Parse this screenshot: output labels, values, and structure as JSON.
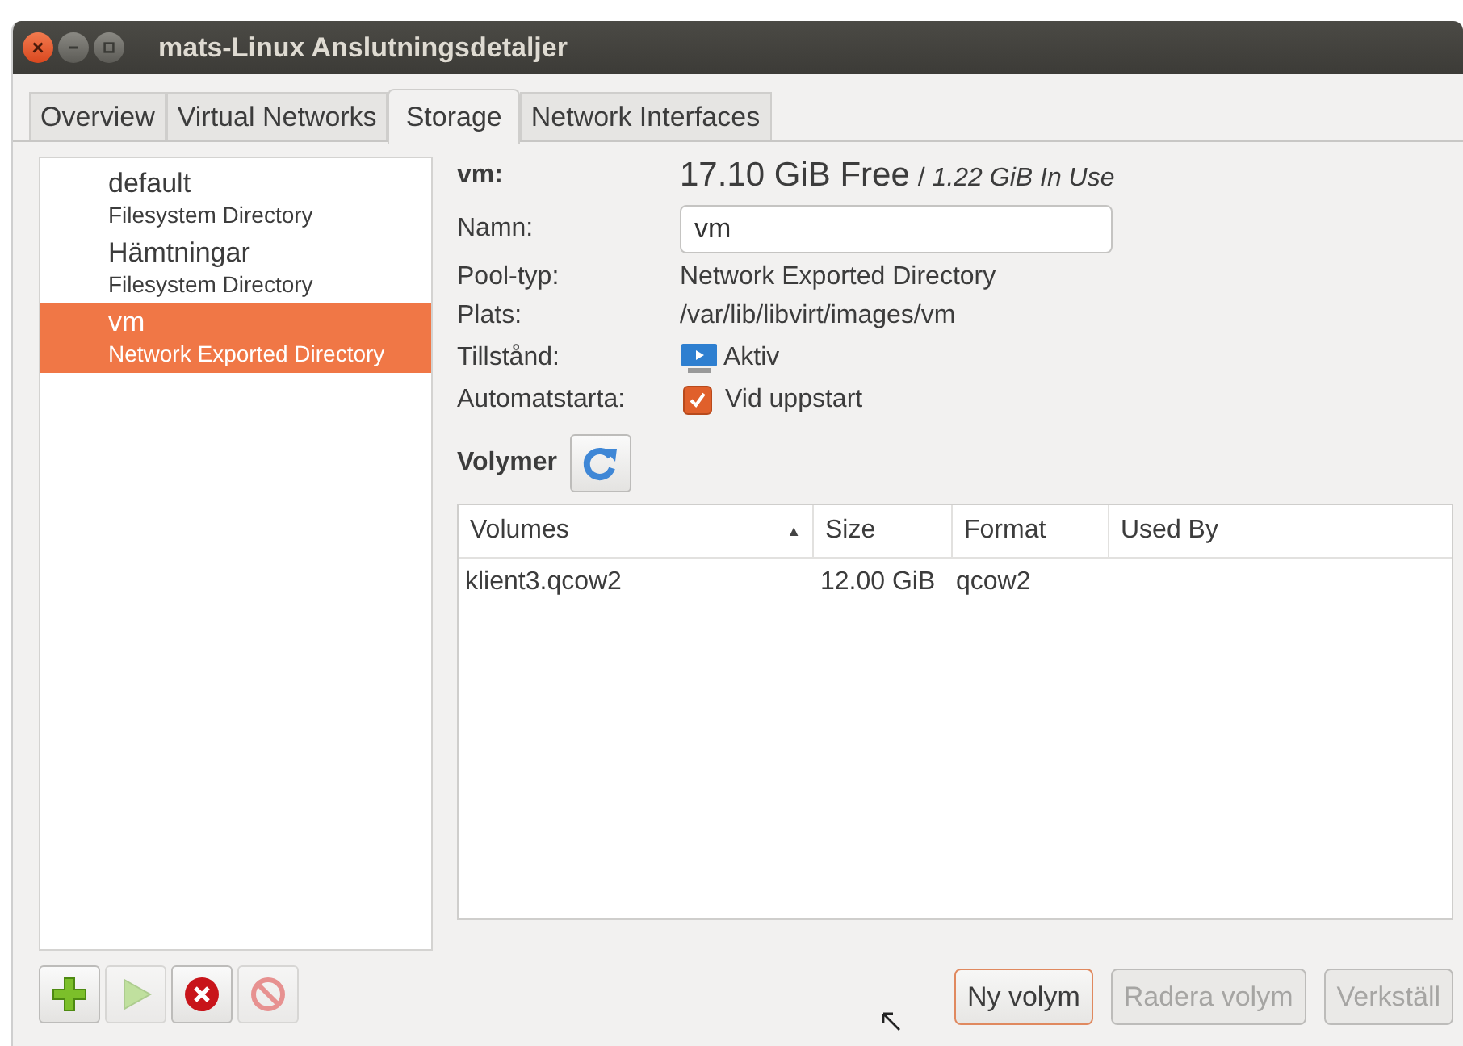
{
  "window": {
    "title": "mats-Linux Anslutningsdetaljer"
  },
  "tabs": [
    {
      "label": "Overview",
      "selected": false
    },
    {
      "label": "Virtual Networks",
      "selected": false
    },
    {
      "label": "Storage",
      "selected": true
    },
    {
      "label": "Network Interfaces",
      "selected": false
    }
  ],
  "pools": [
    {
      "name": "default",
      "type": "Filesystem Directory",
      "selected": false
    },
    {
      "name": "Hämtningar",
      "type": "Filesystem Directory",
      "selected": false
    },
    {
      "name": "vm",
      "type": "Network Exported Directory",
      "selected": true
    }
  ],
  "pool_buttons": [
    {
      "kind": "add",
      "disabled": false
    },
    {
      "kind": "start",
      "disabled": true
    },
    {
      "kind": "stop",
      "disabled": false
    },
    {
      "kind": "delete",
      "disabled": true
    }
  ],
  "details": {
    "header_label": "vm:",
    "free": "17.10 GiB Free",
    "separator": "/",
    "in_use": "1.22 GiB In Use",
    "name_label": "Namn:",
    "name_value": "vm",
    "type_label": "Pool-typ:",
    "type_value": "Network Exported Directory",
    "location_label": "Plats:",
    "location_value": "/var/lib/libvirt/images/vm",
    "state_label": "Tillstånd:",
    "state_value": "Aktiv",
    "autostart_label": "Automatstarta:",
    "autostart_text": "Vid uppstart",
    "autostart_checked": true
  },
  "volumes": {
    "heading": "Volymer",
    "sort_indicator": "▲",
    "columns": [
      "Volumes",
      "Size",
      "Format",
      "Used By"
    ],
    "rows": [
      [
        "klient3.qcow2",
        "12.00 GiB",
        "qcow2",
        ""
      ]
    ]
  },
  "buttons": [
    {
      "label": "Ny volym",
      "disabled": false
    },
    {
      "label": "Radera volym",
      "disabled": true
    },
    {
      "label": "Verkställ",
      "disabled": true
    }
  ]
}
